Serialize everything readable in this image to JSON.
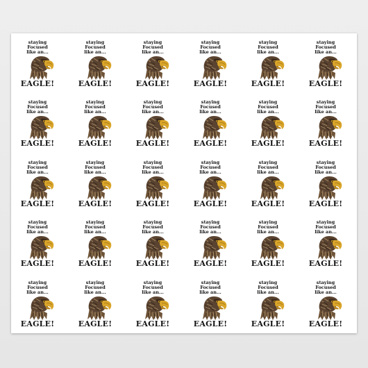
{
  "product": {
    "grid": {
      "columns": 6,
      "rows": 5
    },
    "caption": {
      "line1": "staying",
      "line2": "Focused",
      "line3": "like an...",
      "line4": "EAGLE!"
    },
    "image": {
      "icon": "eagle-head-icon",
      "colors": {
        "feather_dark": "#3b2a1c",
        "feather_mid": "#6e5337",
        "feather_light": "#a98f6b",
        "beak": "#d9a52a",
        "beak_dark": "#9c6f14",
        "eye": "#1a1206"
      }
    },
    "sheet_color": "#ffffff",
    "background_color": "#ececec"
  }
}
